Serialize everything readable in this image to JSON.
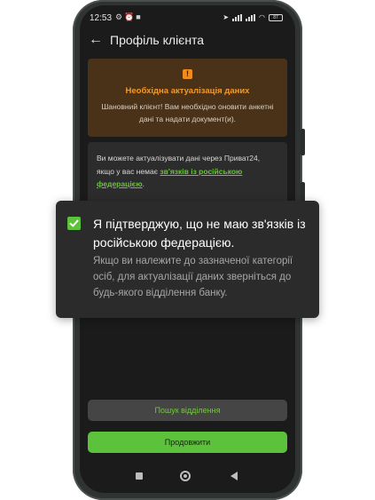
{
  "status_bar": {
    "time": "12:53",
    "battery": "87"
  },
  "header": {
    "back_icon": "arrow-left-icon",
    "title": "Профіль клієнта"
  },
  "warning": {
    "icon": "!",
    "title": "Необхідна актуалізація даних",
    "text": "Шановний клієнт! Вам необхідно оновити анкетні дані та надати документ(и).",
    "colors": {
      "background": "#4a3218",
      "accent": "#f39a2a"
    }
  },
  "info": {
    "text_before": "Ви можете актуалізувати дані через Приват24, якщо у вас немає ",
    "link": "зв'язків із російською федерацією",
    "text_after": "."
  },
  "popup": {
    "checked": true,
    "title": "Я підтверджую, що не маю зв'язків із російською федерацією.",
    "text": "Якщо ви належите до зазначеної категорії осіб, для актуалізації даних зверніться до будь-якого відділення банку."
  },
  "buttons": {
    "search": "Пошук відділення",
    "continue": "Продовжити"
  },
  "colors": {
    "brand_green": "#5cc23b",
    "screen_bg": "#1b1b1b"
  }
}
